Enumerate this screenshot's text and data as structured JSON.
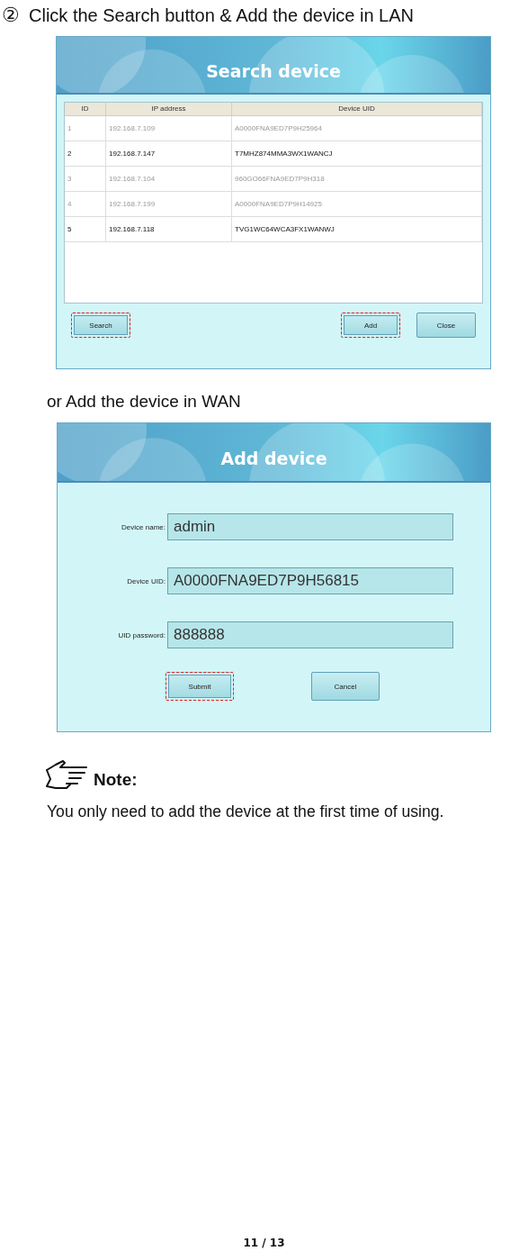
{
  "step": {
    "number": "②",
    "text": "Click the Search button & Add the device in LAN"
  },
  "search_dialog": {
    "title": "Search device",
    "table": {
      "columns": [
        "ID",
        "IP address",
        "Device UID"
      ],
      "rows": [
        {
          "cells": [
            "1",
            "192.168.7.109",
            "A0000FNA9ED7P9H25964"
          ],
          "dimmed": true
        },
        {
          "cells": [
            "2",
            "192.168.7.147",
            "T7MHZ874MMA3WX1WANCJ"
          ],
          "dimmed": false
        },
        {
          "cells": [
            "3",
            "192.168.7.104",
            "960GO66FNA9ED7P9H318"
          ],
          "dimmed": true
        },
        {
          "cells": [
            "4",
            "192.168.7.199",
            "A0000FNA9ED7P9H14925"
          ],
          "dimmed": true
        },
        {
          "cells": [
            "5",
            "192.168.7.118",
            "TVG1WC64WCA3FX1WANWJ"
          ],
          "dimmed": false
        }
      ]
    },
    "left_buttons": [
      {
        "label": "Search",
        "highlighted": true
      }
    ],
    "right_buttons": [
      {
        "label": "Add",
        "highlighted": true
      },
      {
        "label": "Close",
        "highlighted": false
      }
    ]
  },
  "wan_text": "or Add the device in WAN",
  "add_dialog": {
    "title": "Add device",
    "fields": [
      {
        "label": "Device name:",
        "value": "admin"
      },
      {
        "label": "Device UID:",
        "value": "A0000FNA9ED7P9H56815"
      },
      {
        "label": "UID password:",
        "value": "888888"
      }
    ],
    "buttons": [
      {
        "label": "Submit",
        "highlighted": true
      },
      {
        "label": "Cancel",
        "highlighted": false
      }
    ]
  },
  "note": {
    "title": "Note:",
    "text": "You only need to add the device at the first time of using."
  },
  "page_number": "11 / 13"
}
